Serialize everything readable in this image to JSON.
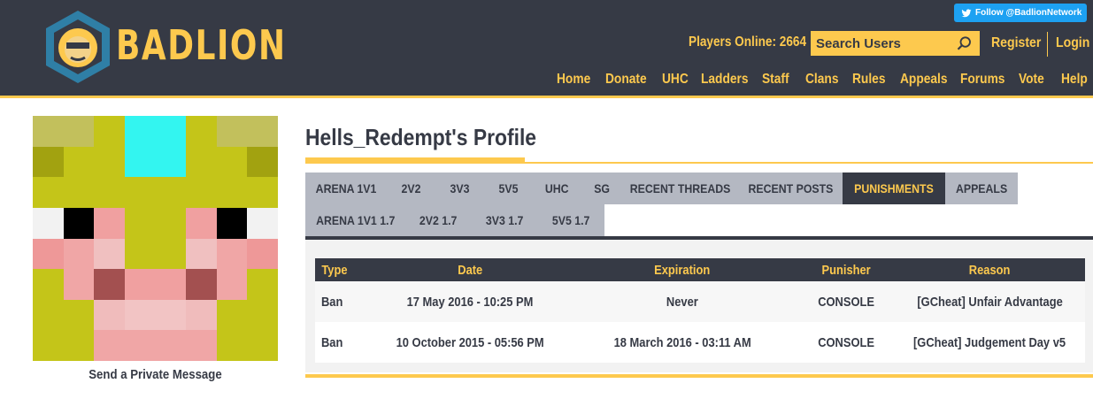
{
  "brand": {
    "name": "BADLION",
    "accent": "#fdc94e",
    "header_bg": "#363a45"
  },
  "twitter": {
    "label": "Follow @BadlionNetwork",
    "icon": "twitter-bird-icon"
  },
  "header": {
    "players_online": "Players Online: 2664",
    "search_placeholder": "Search Users",
    "register": "Register",
    "login": "Login"
  },
  "nav": [
    "Home",
    "Donate",
    "UHC",
    "Ladders",
    "Staff",
    "Clans",
    "Rules",
    "Appeals",
    "Forums",
    "Vote",
    "Help"
  ],
  "profile": {
    "title": "Hells_Redempt's Profile",
    "send_pm": "Send a Private Message"
  },
  "tabs": [
    [
      "ARENA 1V1",
      "2V2",
      "3V3",
      "5V5",
      "UHC",
      "SG",
      "RECENT THREADS",
      "RECENT POSTS",
      "PUNISHMENTS",
      "APPEALS"
    ],
    [
      "ARENA 1V1 1.7",
      "2V2 1.7",
      "3V3 1.7",
      "5V5 1.7"
    ]
  ],
  "active_tab": "PUNISHMENTS",
  "punishments": {
    "headers": [
      "Type",
      "Date",
      "Expiration",
      "Punisher",
      "Reason"
    ],
    "rows": [
      [
        "Ban",
        "17 May 2016 - 10:25 PM",
        "Never",
        "CONSOLE",
        "[GCheat] Unfair Advantage"
      ],
      [
        "Ban",
        "10 October 2015 - 05:56 PM",
        "18 March 2016 - 03:11 AM",
        "CONSOLE",
        "[GCheat] Judgement Day v5"
      ]
    ]
  },
  "avatar_pixels": [
    [
      "#c2c05c",
      "#c2c05c",
      "#c4c519",
      "#33f5f0",
      "#33f5f0",
      "#c4c519",
      "#c2c05c",
      "#c2c05c"
    ],
    [
      "#a2a210",
      "#c4c519",
      "#c4c519",
      "#33f5f0",
      "#33f5f0",
      "#c4c519",
      "#c4c519",
      "#a2a210"
    ],
    [
      "#c4c519",
      "#c4c519",
      "#c4c519",
      "#c4c519",
      "#c4c519",
      "#c4c519",
      "#c4c519",
      "#c4c519"
    ],
    [
      "#f2f2f2",
      "#000000",
      "#f0a0a0",
      "#c4c519",
      "#c4c519",
      "#f0a0a0",
      "#000000",
      "#f2f2f2"
    ],
    [
      "#ee9898",
      "#f0a6a6",
      "#f0c0c0",
      "#c4c519",
      "#c4c519",
      "#f0c0c0",
      "#f0a6a6",
      "#ee9898"
    ],
    [
      "#c4c519",
      "#f0a6a6",
      "#a35050",
      "#f0a0a0",
      "#f0a0a0",
      "#a35050",
      "#f0a6a6",
      "#c4c519"
    ],
    [
      "#c4c519",
      "#c4c519",
      "#f0bcbc",
      "#f2c4c4",
      "#f2c4c4",
      "#f0bcbc",
      "#c4c519",
      "#c4c519"
    ],
    [
      "#c4c519",
      "#c4c519",
      "#f0a6a6",
      "#f0a6a6",
      "#f0a6a6",
      "#f0a6a6",
      "#c4c519",
      "#c4c519"
    ]
  ]
}
